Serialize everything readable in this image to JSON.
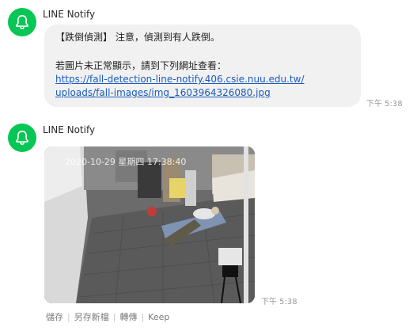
{
  "messages": [
    {
      "sender": "LINE Notify",
      "avatar_icon": "bell-icon",
      "lines": [
        "【跌倒偵測】 注意，偵測到有人跌倒。",
        "",
        "若圖片未正常顯示，請到下列網址查看："
      ],
      "link_lines": [
        "https://fall-detection-line-notify.406.csie.nuu.edu.tw/",
        "uploads/fall-images/img_1603964326080.jpg"
      ],
      "time": "下午 5:38"
    },
    {
      "sender": "LINE Notify",
      "avatar_icon": "bell-icon",
      "image_overlay": "2020-10-29 星期四 17:38:40",
      "time": "下午 5:38",
      "actions": [
        "儲存",
        "另存新檔",
        "轉傳",
        "Keep"
      ]
    }
  ],
  "colors": {
    "avatar": "#06c755",
    "bubble": "#f1f1f1",
    "link": "#1a5bbf"
  }
}
